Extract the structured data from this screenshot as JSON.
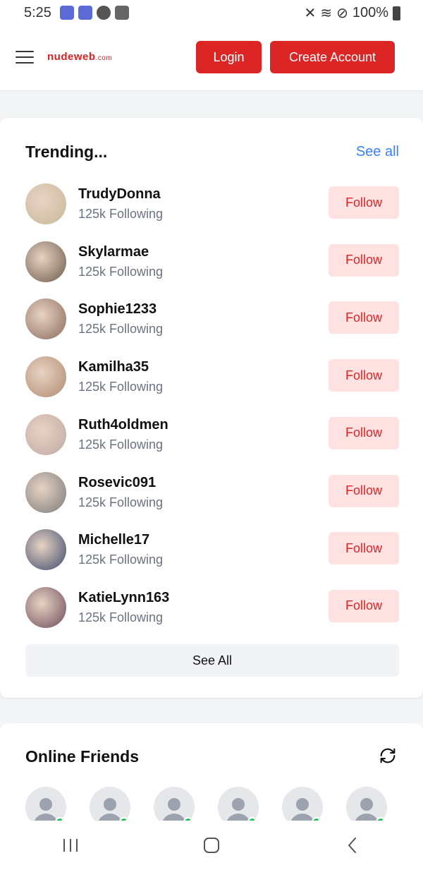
{
  "status_bar": {
    "time": "5:25",
    "battery": "100%"
  },
  "header": {
    "logo": "nudeweb",
    "logo_suffix": ".com",
    "login_label": "Login",
    "create_account_label": "Create Account"
  },
  "trending": {
    "title": "Trending...",
    "see_all_link": "See all",
    "follow_label": "Follow",
    "see_all_button": "See All",
    "users": [
      {
        "name": "TrudyDonna",
        "following": "125k Following",
        "avatar_color": "#c8b99a"
      },
      {
        "name": "Skylarmae",
        "following": "125k Following",
        "avatar_color": "#6b5a4a"
      },
      {
        "name": "Sophie1233",
        "following": "125k Following",
        "avatar_color": "#8a6a5a"
      },
      {
        "name": "Kamilha35",
        "following": "125k Following",
        "avatar_color": "#b08a70"
      },
      {
        "name": "Ruth4oldmen",
        "following": "125k Following",
        "avatar_color": "#bfa9a4"
      },
      {
        "name": "Rosevic091",
        "following": "125k Following",
        "avatar_color": "#7a7a7a"
      },
      {
        "name": "Michelle17",
        "following": "125k Following",
        "avatar_color": "#3b4a6b"
      },
      {
        "name": "KatieLynn163",
        "following": "125k Following",
        "avatar_color": "#6b4b5a"
      }
    ]
  },
  "online_friends": {
    "title": "Online Friends"
  },
  "colors": {
    "accent": "#dc2626",
    "follow_bg": "#fee2e2",
    "link": "#3b82f6",
    "online": "#22c55e"
  },
  "icons": [
    "hamburger-icon",
    "refresh-icon",
    "recent-apps-icon",
    "home-icon",
    "back-icon"
  ]
}
